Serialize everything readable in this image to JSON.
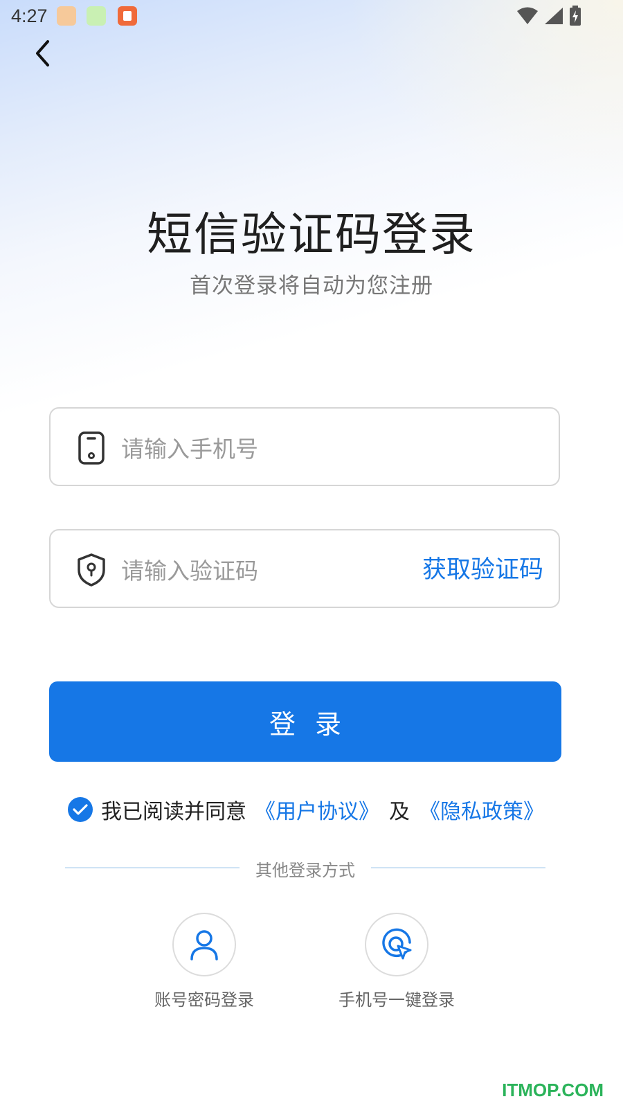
{
  "status_bar": {
    "time": "4:27"
  },
  "header": {
    "title": "短信验证码登录",
    "subtitle": "首次登录将自动为您注册"
  },
  "form": {
    "phone_placeholder": "请输入手机号",
    "code_placeholder": "请输入验证码",
    "get_code_label": "获取验证码",
    "login_label": "登录"
  },
  "agreement": {
    "checked": true,
    "prefix": "我已阅读并同意",
    "user_agreement": "《用户协议》",
    "and": "及",
    "privacy_policy": "《隐私政策》"
  },
  "other_login": {
    "divider_label": "其他登录方式",
    "account_login_label": "账号密码登录",
    "one_key_login_label": "手机号一键登录"
  },
  "watermark": "ITMOP.COM",
  "colors": {
    "accent": "#1677e6",
    "watermark": "#2bb35a"
  }
}
